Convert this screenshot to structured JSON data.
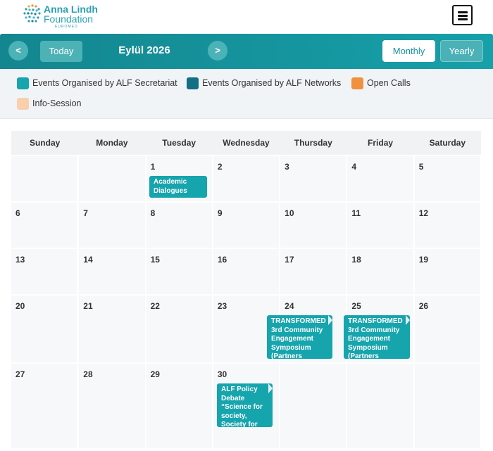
{
  "header": {
    "logo_line1": "Anna Lindh",
    "logo_line2": "Foundation",
    "logo_line3": "EUROMED",
    "menu_icon": "hamburger-menu-icon"
  },
  "toolbar": {
    "prev_label": "<",
    "today_label": "Today",
    "title": "Eylül 2026",
    "next_label": ">",
    "monthly_label": "Monthly",
    "yearly_label": "Yearly"
  },
  "legend": [
    {
      "label": "Events Organised by ALF Secretariat",
      "color": "#16a4ad"
    },
    {
      "label": "Events Organised by ALF Networks",
      "color": "#136f84"
    },
    {
      "label": "Open Calls",
      "color": "#f0913f"
    },
    {
      "label": "Info-Session",
      "color": "#f9cfae"
    }
  ],
  "weekdays": [
    "Sunday",
    "Monday",
    "Tuesday",
    "Wednesday",
    "Thursday",
    "Friday",
    "Saturday"
  ],
  "weeks": [
    [
      "",
      "",
      "1",
      "2",
      "3",
      "4",
      "5"
    ],
    [
      "6",
      "7",
      "8",
      "9",
      "10",
      "11",
      "12"
    ],
    [
      "13",
      "14",
      "15",
      "16",
      "17",
      "18",
      "19"
    ],
    [
      "20",
      "21",
      "22",
      "23",
      "24",
      "25",
      "26"
    ],
    [
      "27",
      "28",
      "29",
      "30",
      "",
      "",
      ""
    ]
  ],
  "events": [
    {
      "day": "1",
      "text": "Academic Dialogues",
      "color": "#16a4ad"
    },
    {
      "day": "24",
      "text": "TRANSFORMED 3rd Community Engagement Symposium (Partners",
      "color": "#16a4ad"
    },
    {
      "day": "25",
      "text": "TRANSFORMED 3rd Community Engagement Symposium (Partners",
      "color": "#16a4ad"
    },
    {
      "day": "30",
      "text": "ALF Policy Debate “Science for society, Society for",
      "color": "#16a4ad"
    }
  ]
}
